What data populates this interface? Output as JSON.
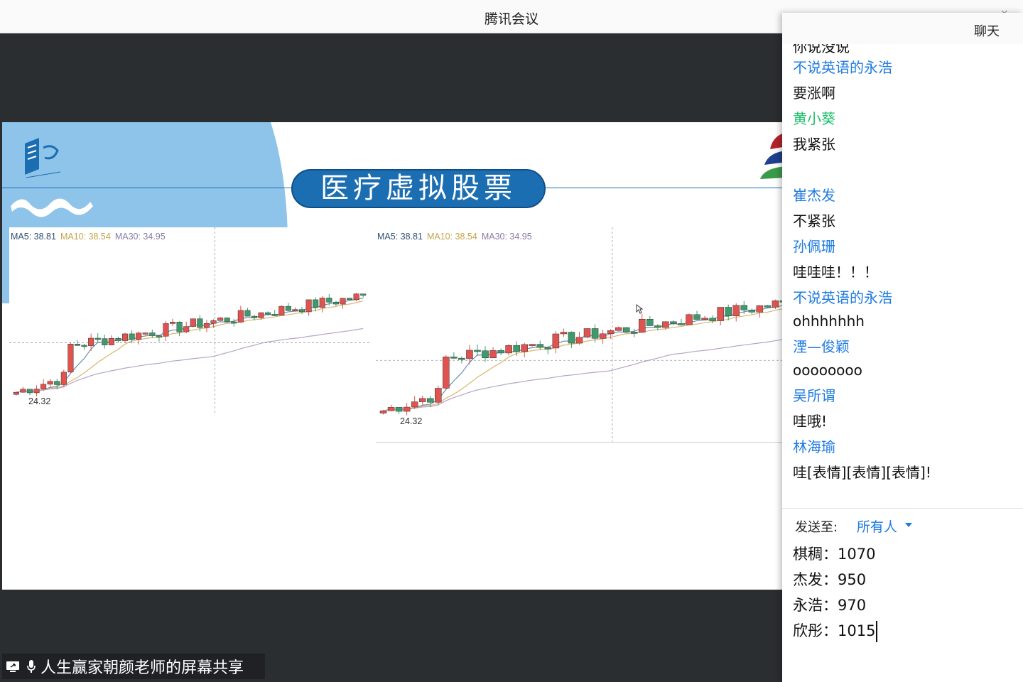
{
  "window": {
    "title": "腾讯会议",
    "controls": {
      "minimize": "—",
      "close": "×"
    }
  },
  "slide": {
    "title": "医疗虚拟股票",
    "charts": [
      {
        "ma5": "MA5: 38.81",
        "ma10": "MA10: 38.54",
        "ma30": "MA30: 34.95",
        "low": "24.32"
      },
      {
        "ma5": "MA5: 38.81",
        "ma10": "MA10: 38.54",
        "ma30": "MA30: 34.95",
        "low": "24.32"
      }
    ]
  },
  "share_tag": {
    "text": "人生赢家朝颜老师的屏幕共享",
    "icons": [
      "screen-share-icon",
      "microphone-icon"
    ]
  },
  "chat": {
    "title": "聊天",
    "partial_top": "你说没说",
    "messages": [
      {
        "name": "不说英语的永浩",
        "name_color": "blue",
        "text": "要涨啊"
      },
      {
        "name": "黄小葵",
        "name_color": "green",
        "text": "我紧张"
      },
      {
        "name": "崔杰发",
        "name_color": "blue",
        "text": "不紧张"
      },
      {
        "name": "孙佩珊",
        "name_color": "blue",
        "text": "哇哇哇！！！"
      },
      {
        "name": "不说英语的永浩",
        "name_color": "blue",
        "text": "ohhhhhhh"
      },
      {
        "name": "湮—俊颖",
        "name_color": "blue",
        "text": "oooooooo"
      },
      {
        "name": "吴所谓",
        "name_color": "blue",
        "text": "哇哦!"
      },
      {
        "name": "林海瑜",
        "name_color": "blue",
        "text": "哇[表情][表情][表情]!"
      }
    ],
    "send_to_label": "发送至:",
    "send_to_value": "所有人",
    "input_lines": [
      "棋稠：1070",
      "杰发：950",
      "永浩：970",
      "欣彤：1015"
    ]
  },
  "colors": {
    "accent": "#1e7be0",
    "green_name": "#1bbf6c",
    "slide_blue": "#1c6eb2",
    "light_blue": "#8ec3ea",
    "candle_up": "#e0534e",
    "candle_down": "#3f9a6b",
    "ma5": "#6b8fb0",
    "ma10": "#d9b56a",
    "ma30": "#b7a3c9"
  }
}
